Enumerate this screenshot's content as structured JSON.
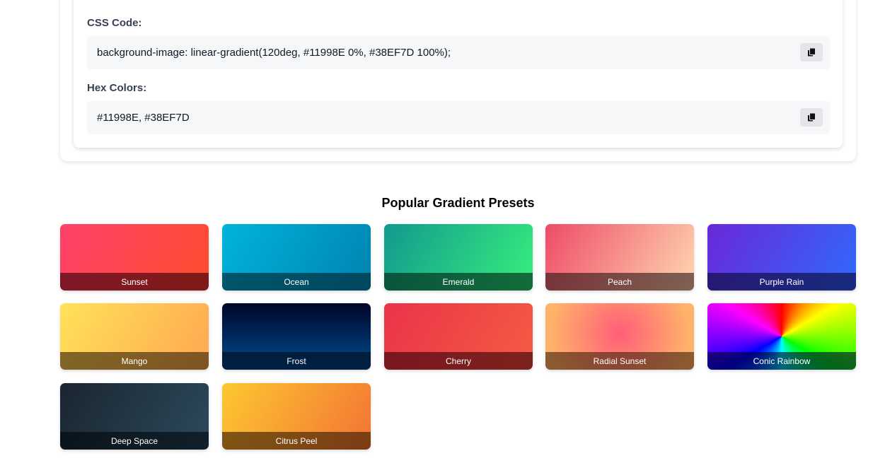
{
  "output": {
    "css_label": "CSS Code:",
    "css_code": "background-image: linear-gradient(120deg, #11998E 0%, #38EF7D 100%);",
    "hex_label": "Hex Colors:",
    "hex_code": "#11998E, #38EF7D",
    "copy_icon": "copy-icon"
  },
  "presets": {
    "title": "Popular Gradient Presets",
    "items": [
      {
        "label": "Sunset",
        "colors": [
          "#ff416c",
          "#ff4b2b"
        ]
      },
      {
        "label": "Ocean",
        "colors": [
          "#00b4db",
          "#0083b0"
        ]
      },
      {
        "label": "Emerald",
        "colors": [
          "#11998e",
          "#38ef7d"
        ]
      },
      {
        "label": "Peach",
        "colors": [
          "#ee4b68",
          "#ffd8b0"
        ]
      },
      {
        "label": "Purple Rain",
        "colors": [
          "#6a28d8",
          "#2f6afc"
        ]
      },
      {
        "label": "Mango",
        "colors": [
          "#ffe259",
          "#ffa751"
        ]
      },
      {
        "label": "Frost",
        "colors": [
          "#000428",
          "#004e92"
        ]
      },
      {
        "label": "Cherry",
        "colors": [
          "#eb3349",
          "#f45c43"
        ]
      },
      {
        "label": "Radial Sunset",
        "colors": [
          "#ff5e78",
          "#ffb36a"
        ]
      },
      {
        "label": "Conic Rainbow",
        "colors": [
          "#ff0000",
          "#ffff00",
          "#00ff00",
          "#00ffff",
          "#0000ff",
          "#ff00ff"
        ]
      },
      {
        "label": "Deep Space",
        "colors": [
          "#1a2530",
          "#2c4a5c"
        ]
      },
      {
        "label": "Citrus Peel",
        "colors": [
          "#fdc830",
          "#f37335"
        ]
      }
    ]
  }
}
